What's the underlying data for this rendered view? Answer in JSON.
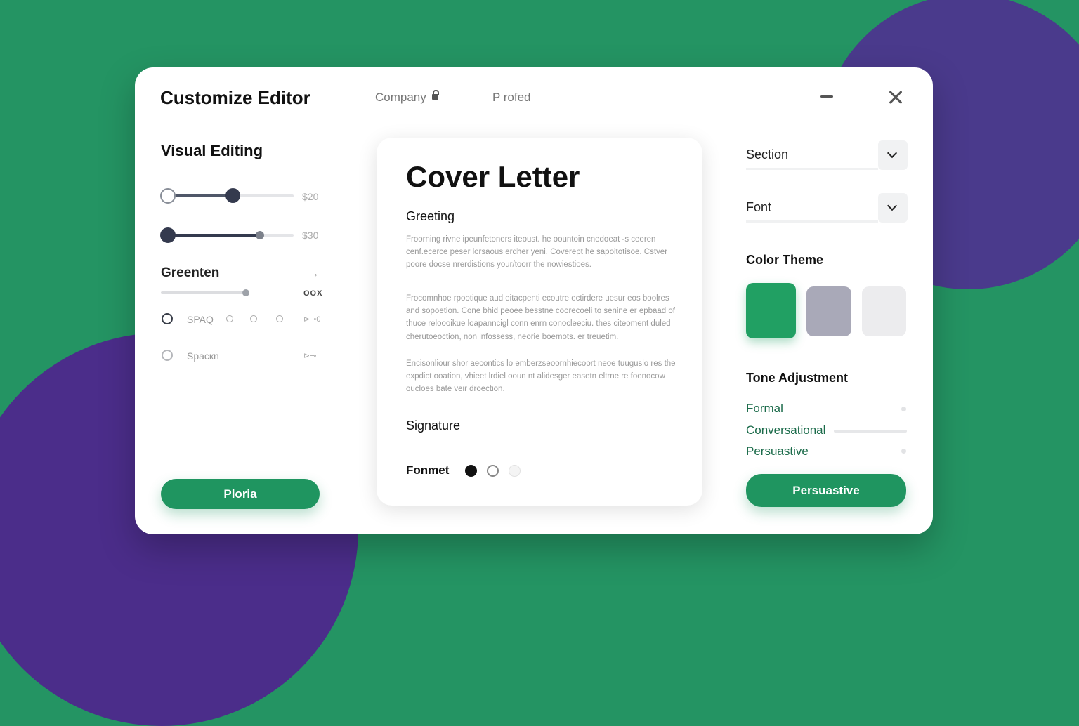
{
  "window": {
    "title": "Customize Editor",
    "tabs": [
      {
        "label": "Company",
        "icon": "lock-icon"
      },
      {
        "label": "P rofed"
      }
    ]
  },
  "left": {
    "heading": "Visual Editing",
    "sliders": [
      {
        "value_label": "$20",
        "value_fraction": 0.55
      },
      {
        "value_label": "$30",
        "value_fraction": 0.75
      }
    ],
    "section": {
      "title": "Greenten",
      "arrow": "→",
      "badge": "OOX",
      "slider_fraction": 0.65
    },
    "options": [
      {
        "label": "SPAQ",
        "trail": "⊳⊸0",
        "selected": true
      },
      {
        "label": "Spacкn",
        "trail": "⊳⊸",
        "selected": false
      }
    ],
    "button": "Ploria"
  },
  "card": {
    "title": "Cover Letter",
    "greeting": "Greeting",
    "paragraphs": [
      "Froorning rivne ipeunfetoners iteoust. he oountoin cnedoeat -s ceeren cenf.ecerce peser lorsaous erdher yeni. Coverept he sapoitotisoe. Cstver poore docse nrerdistions your/toorr the nowiestioes.",
      "Frocomnhoe rpootique aud eitacpenti ecoutre ectirdere uesur eos boolres and sopoetion. Cone bhid peoee besstne coorecoeli to senine er epbaad of thuce reloooikue loapanncigl conn enrn conocleeciu. thes citeoment duled cherutoeoction, non infossess, neorie boemots. er treuetim.",
      "Encisonliour shor aecontics lo emberzseoornhiecoort neoe tuuguslo res the expdict ooation, vhieet lrdiel ooun nt alidesger easetn eltrne re foenocow oucloes bate veir droection."
    ],
    "signature": "Signature",
    "format_label": "Fonmet"
  },
  "right": {
    "section_select": "Section",
    "font_select": "Font",
    "color_theme": "Color Theme",
    "swatches": [
      "#21a063",
      "#a9a9b8",
      "#ececee"
    ],
    "tone_heading": "Tone Adjustment",
    "tones": [
      "Formal",
      "Conversational",
      "Persuastive"
    ],
    "button": "Persuastive"
  }
}
